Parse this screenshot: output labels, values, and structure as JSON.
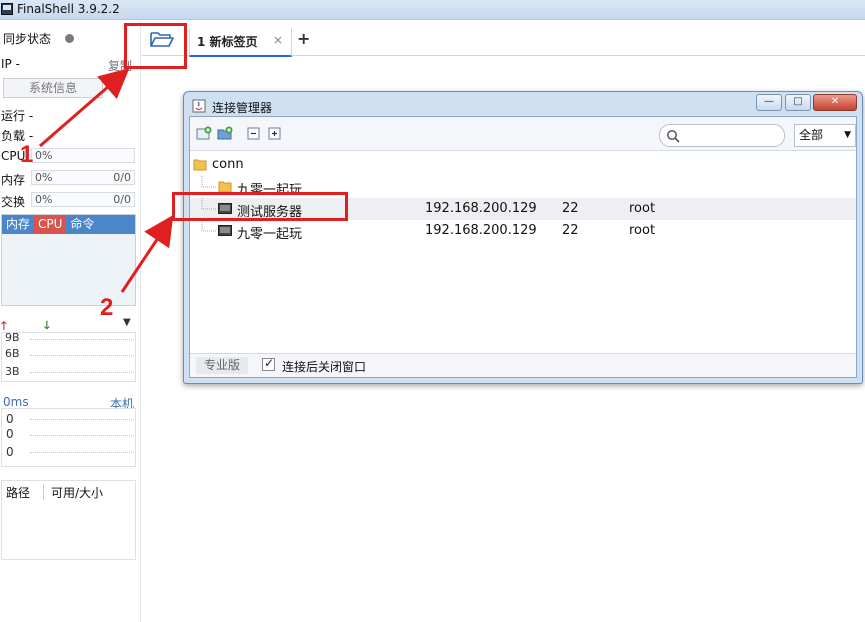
{
  "window": {
    "title": "FinalShell 3.9.2.2"
  },
  "sidebar": {
    "sync_label": "同步状态",
    "ip_label": "IP  -",
    "copy_label": "复制",
    "sysinfo_button": "系统信息",
    "run_label": "运行 -",
    "load_label": "负载 -",
    "cpu": {
      "label": "CPU",
      "value": "0%"
    },
    "mem": {
      "label": "内存",
      "value": "0%",
      "extra": "0/0"
    },
    "swap": {
      "label": "交换",
      "value": "0%",
      "extra": "0/0"
    },
    "proc_headers": [
      "内存",
      "CPU",
      "命令"
    ],
    "net_scale": [
      "9B",
      "6B",
      "3B"
    ],
    "ping": {
      "latency": "0ms",
      "host": "本机",
      "values": [
        "0",
        "0",
        "0"
      ]
    },
    "disk_headers": [
      "路径",
      "可用/大小"
    ]
  },
  "tabs": {
    "active_tab": "1 新标签页",
    "close_glyph": "×",
    "add_glyph": "+"
  },
  "dialog": {
    "title": "连接管理器",
    "search": {
      "placeholder": "",
      "value": ""
    },
    "filter": "全部",
    "tree": {
      "root": "conn",
      "folder": "九零一起玩",
      "rows": [
        {
          "name": "测试服务器",
          "host": "192.168.200.129",
          "port": "22",
          "user": "root",
          "selected": true
        },
        {
          "name": "九零一起玩",
          "host": "192.168.200.129",
          "port": "22",
          "user": "root",
          "selected": false
        }
      ]
    },
    "status": {
      "edition": "专业版",
      "close_after_connect": "连接后关闭窗口",
      "close_after_connect_checked": true
    },
    "window_buttons": {
      "minimize": "—",
      "maximize": "□",
      "close": "✕"
    }
  },
  "annotations": {
    "step1": "1",
    "step2": "2",
    "color": "#e02020"
  }
}
